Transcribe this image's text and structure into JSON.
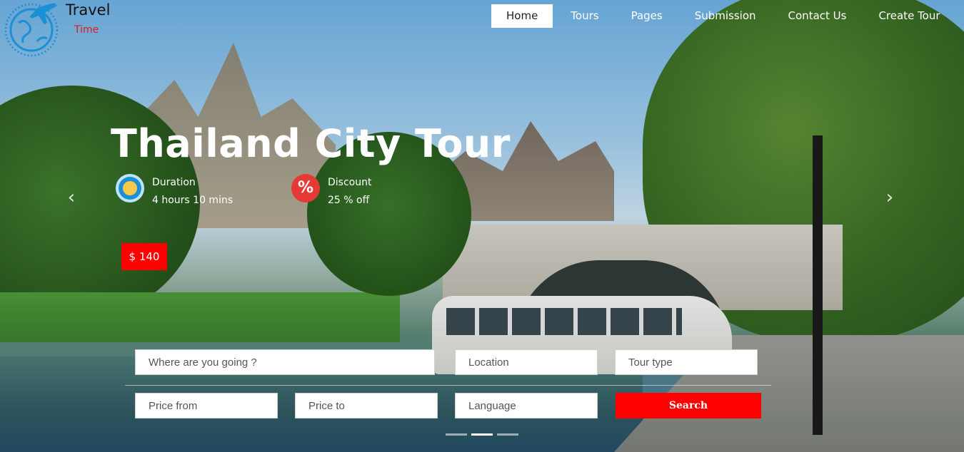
{
  "brand": {
    "title": "Travel",
    "subtitle": "Time",
    "logo_icon": "globe-plane-icon",
    "accent": "#1d8fd6",
    "subtitle_color": "#e21b1b"
  },
  "nav": {
    "items": [
      {
        "label": "Home",
        "active": true
      },
      {
        "label": "Tours",
        "active": false
      },
      {
        "label": "Pages",
        "active": false
      },
      {
        "label": "Submission",
        "active": false
      },
      {
        "label": "Contact Us",
        "active": false
      },
      {
        "label": "Create Tour",
        "active": false
      }
    ]
  },
  "slide": {
    "title": "Thailand City Tour",
    "duration": {
      "label": "Duration",
      "value": "4 hours 10 mins",
      "icon": "clock-icon"
    },
    "discount": {
      "label": "Discount",
      "value": "25 % off",
      "icon": "percent-icon"
    },
    "price": "$ 140",
    "prev_icon": "‹",
    "next_icon": "›",
    "slide_count": 3,
    "active_slide": 2
  },
  "search": {
    "destination_placeholder": "Where are you going ?",
    "location_placeholder": "Location",
    "tour_type_placeholder": "Tour type",
    "price_from_placeholder": "Price from",
    "price_to_placeholder": "Price to",
    "language_placeholder": "Language",
    "button_label": "Search"
  },
  "colors": {
    "primary_red": "#ff0000",
    "nav_text": "#ffffff"
  }
}
